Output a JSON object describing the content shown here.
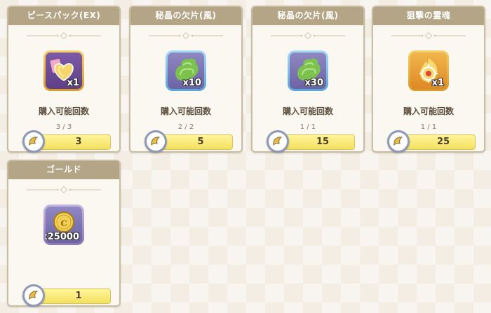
{
  "cards": [
    {
      "title": "ピースパック(EX)",
      "quantity": "x1",
      "limit_label": "購入可能回数",
      "limit_count": "3 / 3",
      "price": "3",
      "icon": "heart-piece-pack-icon"
    },
    {
      "title": "秘晶の欠片(風)",
      "quantity": "x10",
      "limit_label": "購入可能回数",
      "limit_count": "2 / 2",
      "price": "5",
      "icon": "wind-crystal-shard-icon"
    },
    {
      "title": "秘晶の欠片(風)",
      "quantity": "x30",
      "limit_label": "購入可能回数",
      "limit_count": "1 / 1",
      "price": "15",
      "icon": "wind-crystal-shard-icon"
    },
    {
      "title": "狙撃の霊魂",
      "quantity": "x1",
      "limit_label": "購入可能回数",
      "limit_count": "1 / 1",
      "price": "25",
      "icon": "sniper-soul-icon"
    },
    {
      "title": "ゴールド",
      "quantity": "x25000",
      "price": "1",
      "icon": "gold-coin-icon"
    }
  ],
  "currency_icon": "horn-currency-icon"
}
